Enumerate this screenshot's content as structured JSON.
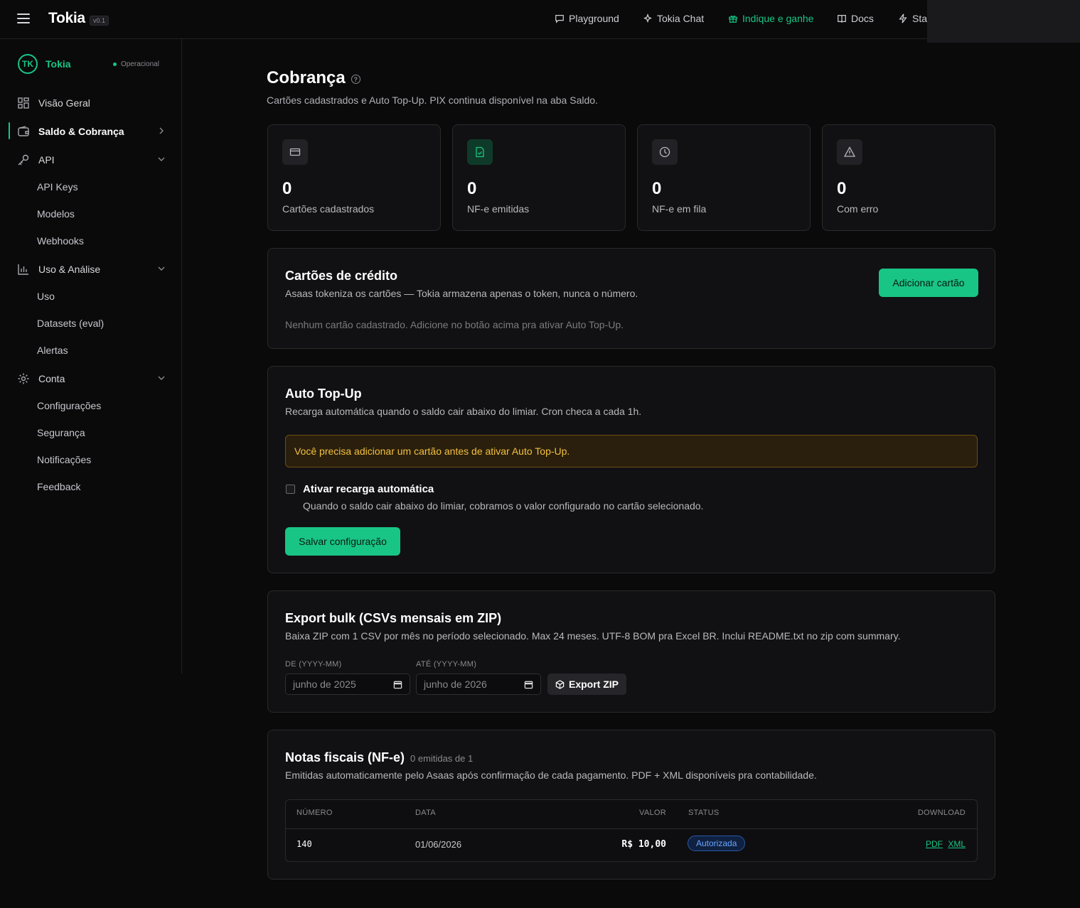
{
  "topbar": {
    "brand": "Tokia",
    "version": "v0.1",
    "nav": [
      {
        "label": "Playground",
        "icon": "chat-bubble-icon"
      },
      {
        "label": "Tokia Chat",
        "icon": "sparkles-icon"
      },
      {
        "label": "Indique e ganhe",
        "icon": "gift-icon",
        "accent": "#19c585"
      },
      {
        "label": "Docs",
        "icon": "book-icon"
      },
      {
        "label": "Sta",
        "icon": "lightning-icon"
      }
    ]
  },
  "sidebar": {
    "org_initials": "TK",
    "org_name": "Tokia",
    "org_status": "Operacional",
    "items": [
      {
        "label": "Visão Geral",
        "icon": "grid-icon"
      },
      {
        "label": "Saldo & Cobrança",
        "icon": "wallet-icon",
        "active": true
      },
      {
        "label": "API",
        "icon": "key-icon"
      },
      {
        "label": "API Keys"
      },
      {
        "label": "Modelos"
      },
      {
        "label": "Webhooks"
      },
      {
        "label": "Uso & Análise",
        "icon": "bar-chart-icon"
      },
      {
        "label": "Uso"
      },
      {
        "label": "Datasets (eval)"
      },
      {
        "label": "Alertas"
      },
      {
        "label": "Conta",
        "icon": "gear-icon"
      },
      {
        "label": "Configurações"
      },
      {
        "label": "Segurança"
      },
      {
        "label": "Notificações"
      },
      {
        "label": "Feedback"
      }
    ]
  },
  "page": {
    "title": "Cobrança",
    "subtitle": "Cartões cadastrados e Auto Top-Up. PIX continua disponível na aba Saldo."
  },
  "stats": [
    {
      "value": "0",
      "label": "Cartões cadastrados",
      "icon": "credit-card-icon"
    },
    {
      "value": "0",
      "label": "NF-e emitidas",
      "icon": "file-check-icon"
    },
    {
      "value": "0",
      "label": "NF-e em fila",
      "icon": "clock-icon"
    },
    {
      "value": "0",
      "label": "Com erro",
      "icon": "alert-triangle-icon"
    }
  ],
  "cards_panel": {
    "title": "Cartões de crédito",
    "subtitle": "Asaas tokeniza os cartões — Tokia armazena apenas o token, nunca o número.",
    "add_button": "Adicionar cartão",
    "empty": "Nenhum cartão cadastrado. Adicione no botão acima pra ativar Auto Top-Up."
  },
  "topup_panel": {
    "title": "Auto Top-Up",
    "subtitle": "Recarga automática quando o saldo cair abaixo do limiar. Cron checa a cada 1h.",
    "warning": "Você precisa adicionar um cartão antes de ativar Auto Top-Up.",
    "checkbox_label": "Ativar recarga automática",
    "checkbox_desc": "Quando o saldo cair abaixo do limiar, cobramos o valor configurado no cartão selecionado.",
    "save_button": "Salvar configuração"
  },
  "export_panel": {
    "title": "Export bulk (CSVs mensais em ZIP)",
    "subtitle": "Baixa ZIP com 1 CSV por mês no período selecionado. Max 24 meses. UTF-8 BOM pra Excel BR. Inclui README.txt no zip com summary.",
    "from_label": "DE (YYYY-MM)",
    "from_value": "junho de 2025",
    "to_label": "ATÉ (YYYY-MM)",
    "to_value": "junho de 2026",
    "export_button": "Export ZIP"
  },
  "nfe_panel": {
    "title": "Notas fiscais (NF-e)",
    "count_text": "0 emitidas de 1",
    "subtitle": "Emitidas automaticamente pelo Asaas após confirmação de cada pagamento. PDF + XML disponíveis pra contabilidade.",
    "columns": [
      "NÚMERO",
      "DATA",
      "VALOR",
      "STATUS",
      "DOWNLOAD"
    ],
    "rows": [
      {
        "numero": "140",
        "data": "01/06/2026",
        "valor": "R$ 10,00",
        "status": "Autorizada",
        "pdf": "PDF",
        "xml": "XML"
      }
    ]
  }
}
